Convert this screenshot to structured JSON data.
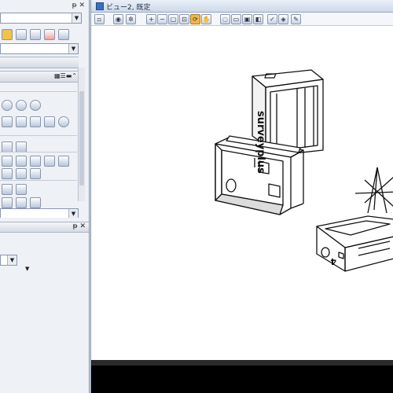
{
  "view_window": {
    "title": "ビュー2, 既定"
  },
  "left_panel": {
    "pin_top": "ᵽ ✕",
    "pin_lower": "ᵽ ✕"
  },
  "model": {
    "brand_text": "surveyplus",
    "part_mark": "4"
  },
  "icons": {
    "view_toolbar": [
      "view-menu-icon",
      "fit-view-icon",
      "rotate-view-icon",
      "zoom-in-icon",
      "zoom-out-icon",
      "window-area-icon",
      "fit-icon",
      "rotate-icon",
      "pan-icon",
      "view-previous-icon",
      "view-next-icon",
      "copy-view-icon",
      "display-style-icon",
      "view-attributes-icon",
      "clip-volume-icon",
      "render-icon"
    ]
  },
  "colors": {
    "accent": "#f0b84a",
    "chrome": "#d4dbe6",
    "view_bg": "#ffffff"
  }
}
